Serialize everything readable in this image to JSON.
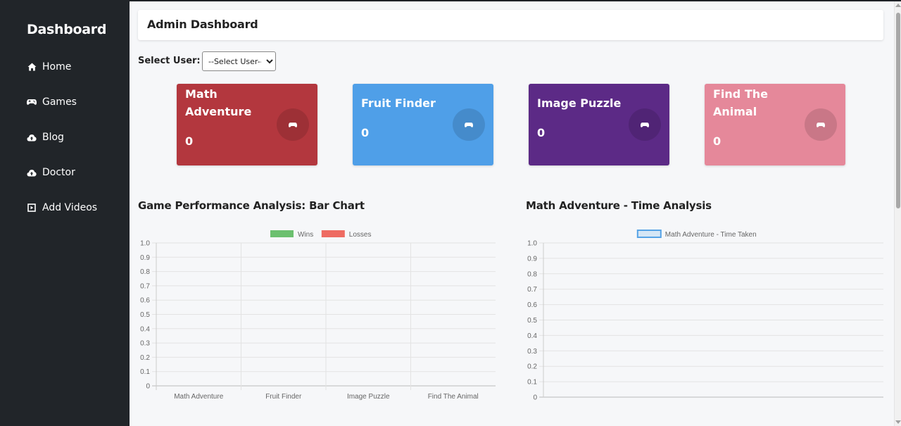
{
  "sidebar": {
    "brand": "Dashboard",
    "items": [
      {
        "label": "Home",
        "icon": "home-icon"
      },
      {
        "label": "Games",
        "icon": "gamepad-icon"
      },
      {
        "label": "Blog",
        "icon": "cloud-upload-icon"
      },
      {
        "label": "Doctor",
        "icon": "cloud-upload-icon"
      },
      {
        "label": "Add Videos",
        "icon": "square-play-icon"
      }
    ]
  },
  "header": {
    "title": "Admin Dashboard"
  },
  "user_select": {
    "label": "Select User:",
    "selected": "--Select User--"
  },
  "cards": [
    {
      "title": "Math Adventure",
      "value": "0",
      "color": "#b3373e"
    },
    {
      "title": "Fruit Finder",
      "value": "0",
      "color": "#4f9fe8"
    },
    {
      "title": "Image Puzzle",
      "value": "0",
      "color": "#5c2a86"
    },
    {
      "title": "Find The Animal",
      "value": "0",
      "color": "#e5889a"
    }
  ],
  "chart_titles": {
    "bar": "Game Performance Analysis: Bar Chart",
    "time": "Math Adventure - Time Analysis"
  },
  "chart_data": [
    {
      "type": "bar",
      "categories": [
        "Math Adventure",
        "Fruit Finder",
        "Image Puzzle",
        "Find The Animal"
      ],
      "series": [
        {
          "name": "Wins",
          "values": [
            0,
            0,
            0,
            0
          ],
          "color": "#6cc06f"
        },
        {
          "name": "Losses",
          "values": [
            0,
            0,
            0,
            0
          ],
          "color": "#ee6b62"
        }
      ],
      "ylim": [
        0,
        1
      ],
      "yticks": [
        "1.0",
        "0.9",
        "0.8",
        "0.7",
        "0.6",
        "0.5",
        "0.4",
        "0.3",
        "0.2",
        "0.1",
        "0"
      ],
      "legend": "top-center",
      "grid": true
    },
    {
      "type": "line",
      "categories": [],
      "series": [
        {
          "name": "Math Adventure - Time Taken",
          "values": [],
          "color": "#56a3e6"
        }
      ],
      "ylim": [
        0,
        1
      ],
      "yticks": [
        "1.0",
        "0.9",
        "0.8",
        "0.7",
        "0.6",
        "0.5",
        "0.4",
        "0.3",
        "0.2",
        "0.1",
        "0"
      ],
      "legend": "top-center",
      "grid": true
    }
  ]
}
